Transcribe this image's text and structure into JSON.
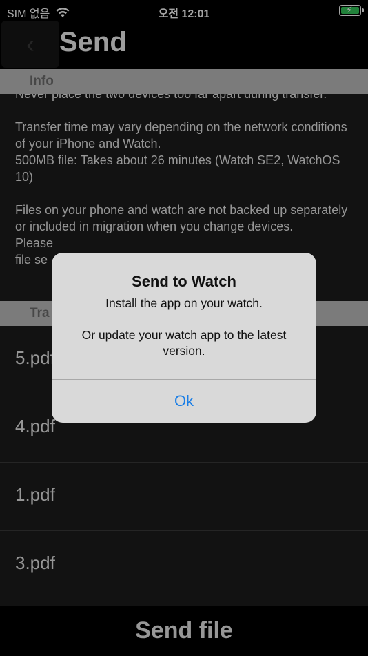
{
  "status_bar": {
    "carrier": "SIM 없음",
    "time": "오전 12:01"
  },
  "nav": {
    "back_glyph": "‹",
    "title": "Send"
  },
  "info_section": {
    "header": "Info",
    "text": "Never place the two devices too far apart during transfer.\n\nTransfer time may vary depending on the network conditions of your iPhone and Watch.\n500MB file: Takes about 26 minutes (Watch SE2, WatchOS 10)\n\nFiles on your phone and watch are not backed up separately or included in migration when you change devices.\nPlease\nfile se"
  },
  "transfer_section": {
    "header": "Tra",
    "files": [
      {
        "name": "5.pdf"
      },
      {
        "name": "4.pdf"
      },
      {
        "name": "1.pdf"
      },
      {
        "name": "3.pdf"
      }
    ]
  },
  "send_file_label": "Send file",
  "alert": {
    "title": "Send to Watch",
    "message": "Install the app on your watch.\n\nOr update your watch app to the latest version.",
    "ok_label": "Ok"
  },
  "colors": {
    "accent": "#1a7ee6",
    "battery": "#34c759"
  }
}
